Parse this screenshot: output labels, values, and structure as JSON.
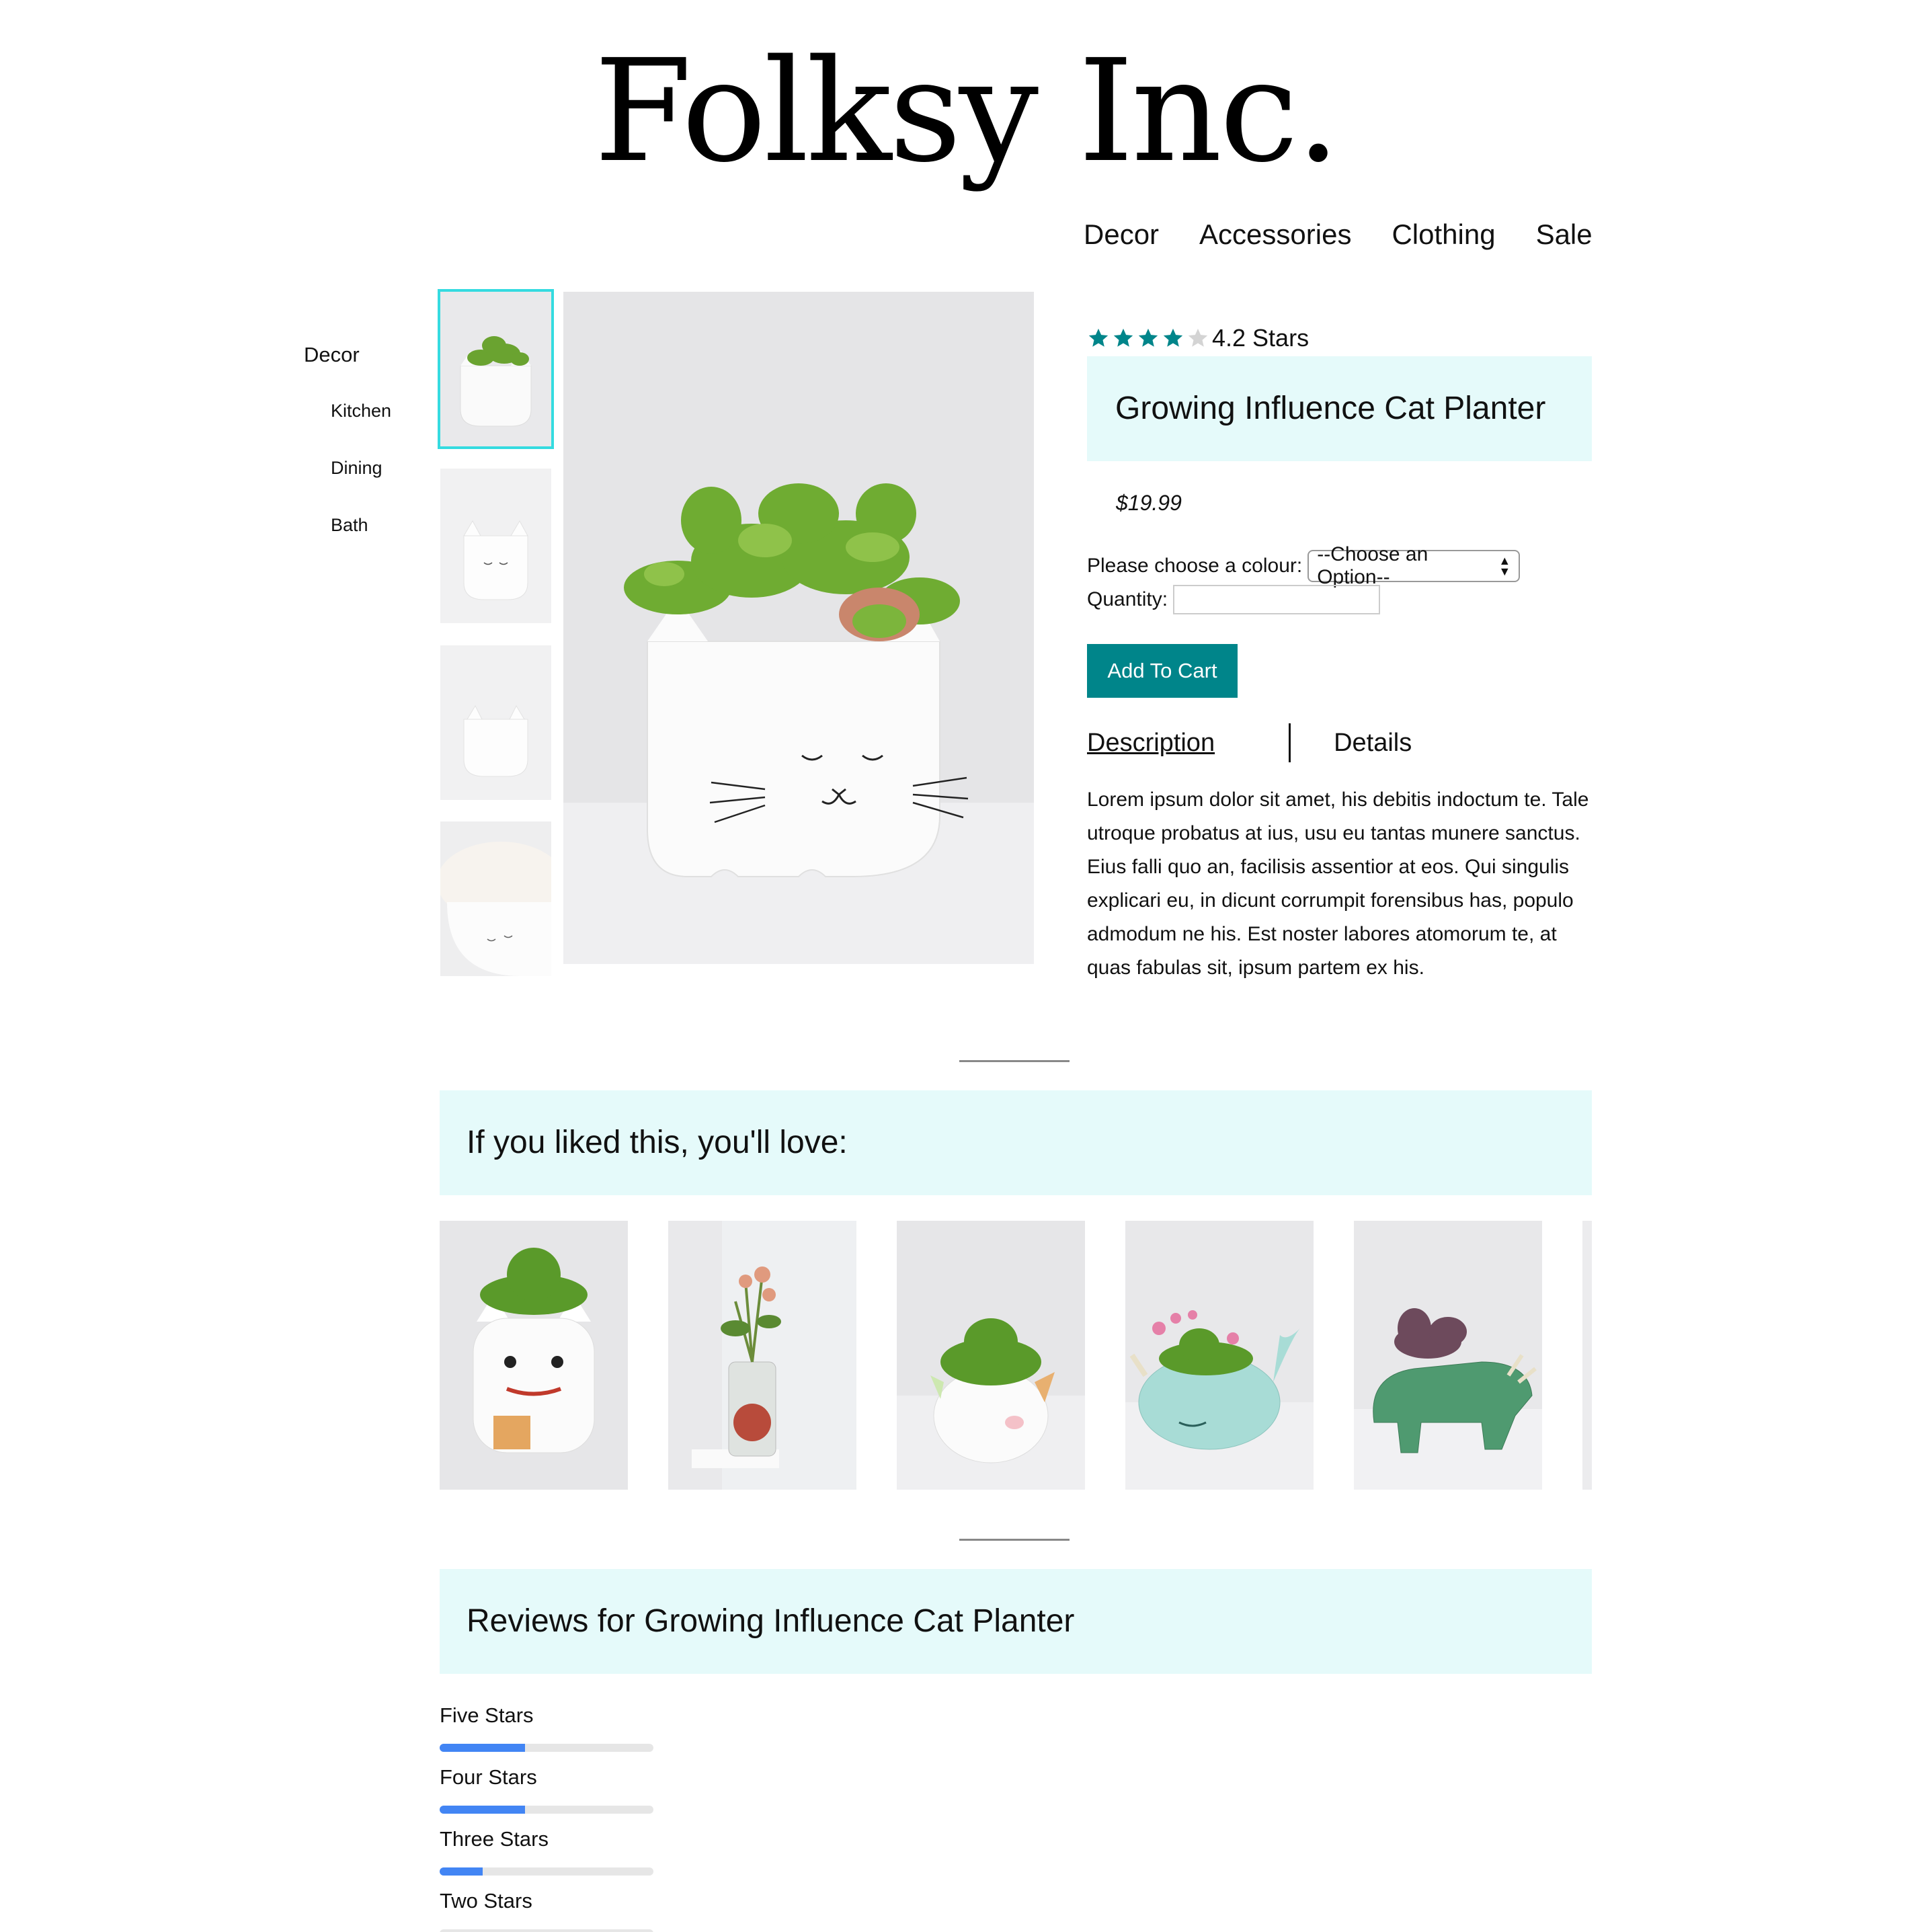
{
  "brand": {
    "logo_text": "Folksy Inc."
  },
  "nav": {
    "items": [
      "Decor",
      "Accessories",
      "Clothing",
      "Sale"
    ]
  },
  "sidebar": {
    "category": "Decor",
    "subcategories": [
      "Kitchen",
      "Dining",
      "Bath"
    ]
  },
  "product": {
    "rating_text": "4.2 Stars",
    "rating_value": 4.2,
    "stars_filled": 4,
    "stars_total": 5,
    "title": "Growing Influence Cat Planter",
    "price": "$19.99",
    "colour_label": "Please choose a colour:",
    "colour_select_value": "--Choose an Option--",
    "quantity_label": "Quantity:",
    "quantity_value": "",
    "add_to_cart_label": "Add To Cart",
    "tabs": [
      "Description",
      "Details"
    ],
    "description": "Lorem ipsum dolor sit amet, his debitis indoctum te. Tale utroque probatus at ius, usu eu tantas munere sanctus. Eius falli quo an, facilisis assentior at eos. Qui singulis explicari eu, in dicunt corrumpit forensibus has, populo admodum ne his. Est noster labores atomorum te, at quas fabulas sit, ipsum partem ex his."
  },
  "recommendations": {
    "heading": "If you liked this, you'll love:"
  },
  "reviews": {
    "heading": "Reviews for Growing Influence Cat Planter",
    "breakdown": [
      {
        "label": "Five Stars",
        "fraction": 0.4
      },
      {
        "label": "Four Stars",
        "fraction": 0.4
      },
      {
        "label": "Three Stars",
        "fraction": 0.2
      },
      {
        "label": "Two Stars",
        "fraction": 0.0
      }
    ]
  },
  "colors": {
    "accent": "#00858a",
    "banner_bg": "#e5fafa",
    "active_thumb": "#35dbe0",
    "star": "#00858a",
    "review_bar": "#4285f4"
  }
}
